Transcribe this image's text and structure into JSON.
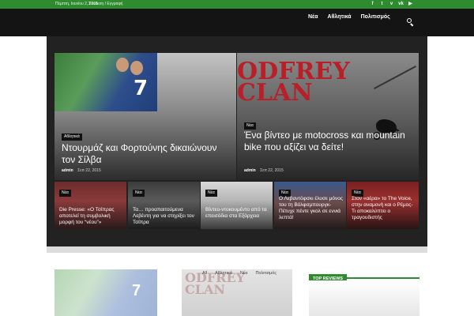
{
  "topbar": {
    "date": "Πέμπτη, Ιουνίου 2, 2016",
    "login": "Σύνδεση / Εγγραφή"
  },
  "social_icons": [
    "facebook-icon",
    "twitter-icon",
    "vimeo-icon",
    "vk-icon",
    "youtube-icon"
  ],
  "nav": {
    "items": [
      "Νέα",
      "Αθλητικά",
      "Πολιτισμός"
    ]
  },
  "featured": [
    {
      "category": "Αθλητικά",
      "title": "Ντουρμάζ και Φορτούνης δικαιώνουν τον Σίλβα",
      "author": "admin",
      "date": "Σεπ 22, 2015"
    },
    {
      "category": "Νέα",
      "title": "Ένα βίντεο με motocross και mountain bike που αξίζει να δείτε!",
      "author": "admin",
      "date": "Σεπ 22, 2015",
      "image_text": "ODFREY\nCLAN"
    }
  ],
  "small_posts": [
    {
      "category": "Νέα",
      "title": "Die Presse: «Ο Τσίπρας αποτελεί τη συμβολική μορφή του “νέου”»"
    },
    {
      "category": "Νέα",
      "title": "Τα… προαπαιτούμενα Λεβέντη για να στηρίξει τον Τσίπρα"
    },
    {
      "category": "Νέα",
      "title": "Βίντεο-ντοκουμέντο από τα επεισόδια στα Εξάρχεια"
    },
    {
      "category": "Νέα",
      "title": "Ο Λεβαντόφσκι έλυσε μόνος του τη Βόλφσμπουργκ-Πέτυχε πέντε γκολ σε εννιά λεπτά!"
    },
    {
      "category": "Νέα",
      "title": "Στον «αέρα» το The Voice, στην αναμονή και ο Ρέμος- Τι αποκαλύπτει ο τραγουδιστής"
    }
  ],
  "lower": {
    "filters": [
      "All",
      "Αθλητικά",
      "Νέα",
      "Πολιτισμός"
    ],
    "image_text": "ODFREY\nCLAN",
    "reviews_title": "TOP REVIEWS"
  },
  "colors": {
    "accent": "#2e8b2e",
    "header_bg": "#141414",
    "container_bg": "#222222"
  }
}
